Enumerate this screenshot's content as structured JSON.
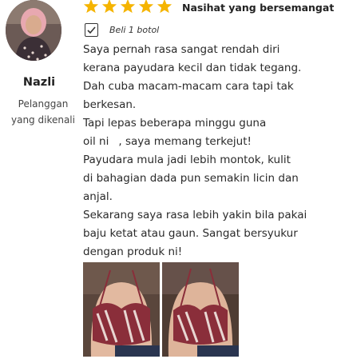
{
  "reviewer": {
    "name": "Nazli",
    "role_line1": "Pelanggan",
    "role_line2": "yang dikenali"
  },
  "rating": {
    "stars": 5,
    "max": 5,
    "star_color": "#F5B400"
  },
  "headline": "Nasihat yang bersemangat",
  "verified_label": "Beli 1 botol",
  "review_lines": [
    "Saya pernah rasa sangat rendah diri",
    "kerana payudara kecil dan tidak tegang.",
    "Dah cuba macam-macam cara tapi tak",
    "berkesan.",
    "Tapi lepas beberapa minggu guna",
    "oil ni",
    ", saya memang terkejut!",
    "Payudara mula jadi lebih montok, kulit",
    "di bahagian dada pun semakin licin dan",
    "anjal.",
    "Sekarang saya rasa lebih yakin bila pakai",
    "baju ketat atau gaun. Sangat bersyukur",
    "dengan produk ni!"
  ],
  "icons": {
    "star": "star-icon",
    "verified": "checkbox-check-icon"
  }
}
